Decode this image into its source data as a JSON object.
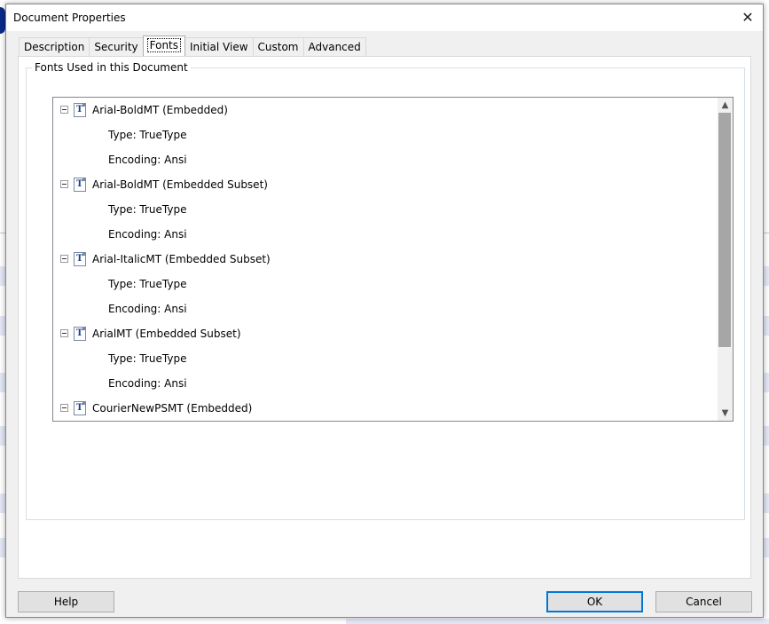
{
  "dialog": {
    "title": "Document Properties",
    "close_glyph": "✕"
  },
  "tabs": [
    {
      "label": "Description"
    },
    {
      "label": "Security"
    },
    {
      "label": "Fonts",
      "active": true
    },
    {
      "label": "Initial View"
    },
    {
      "label": "Custom"
    },
    {
      "label": "Advanced"
    }
  ],
  "fonts_group": {
    "label": "Fonts Used in this Document"
  },
  "fonts": [
    {
      "name": "Arial-BoldMT (Embedded)",
      "type": "Type: TrueType",
      "encoding": "Encoding: Ansi"
    },
    {
      "name": "Arial-BoldMT (Embedded Subset)",
      "type": "Type: TrueType",
      "encoding": "Encoding: Ansi"
    },
    {
      "name": "Arial-ItalicMT (Embedded Subset)",
      "type": "Type: TrueType",
      "encoding": "Encoding: Ansi"
    },
    {
      "name": "ArialMT (Embedded Subset)",
      "type": "Type: TrueType",
      "encoding": "Encoding: Ansi"
    },
    {
      "name": "CourierNewPSMT (Embedded)"
    }
  ],
  "icons": {
    "expander": "minus-box-icon",
    "font": "truetype-font-icon",
    "font_glyph": "T",
    "scroll_up": "▲",
    "scroll_down": "▼"
  },
  "buttons": {
    "help": "Help",
    "ok": "OK",
    "cancel": "Cancel"
  },
  "colors": {
    "default_button_border": "#0078d7",
    "dialog_bg": "#f0f0f0",
    "scroll_thumb": "#a6a6a6"
  }
}
